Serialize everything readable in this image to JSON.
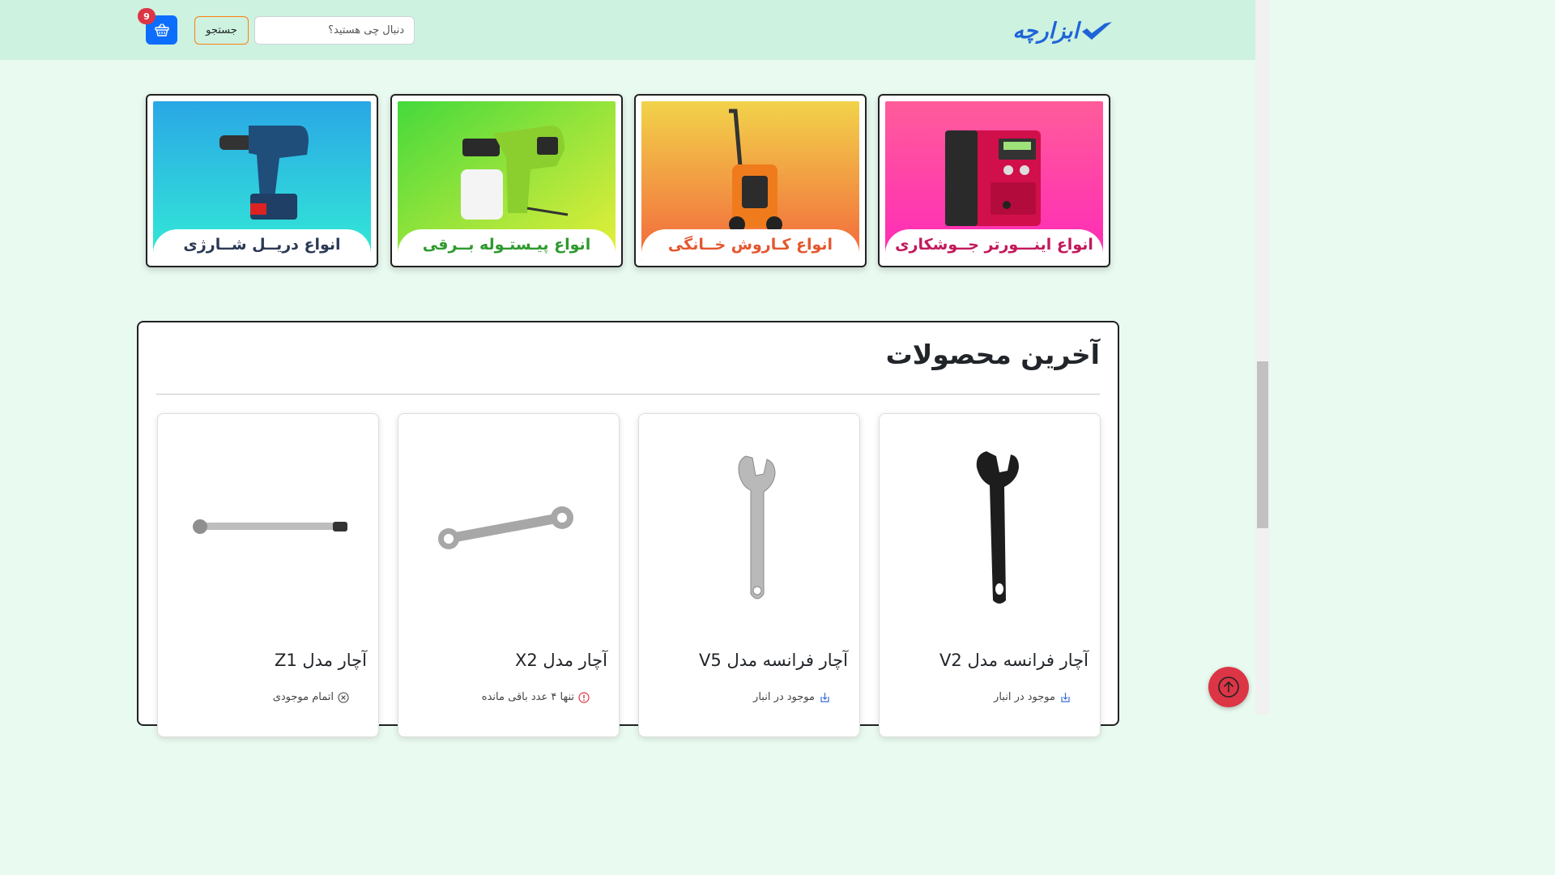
{
  "header": {
    "logo_text": "ابزارچه",
    "search_placeholder": "دنبال چی هستید؟",
    "search_button": "جستجو",
    "cart_count": "9",
    "accent": "#0d6efd",
    "badge_color": "#dc3545"
  },
  "categories": [
    {
      "label": "انواع اینـــورتر جــوشکاری",
      "label_color": "#c2185b",
      "icon": "welding-inverter-image"
    },
    {
      "label": "انواع کـاروش خــانگی",
      "label_color": "#e4572e",
      "icon": "pressure-washer-image"
    },
    {
      "label": "انواع پیـستـوله بــرقی",
      "label_color": "#2e9a2e",
      "icon": "spray-gun-image"
    },
    {
      "label": "انواع دریــل شــارژی",
      "label_color": "#2b3a55",
      "icon": "cordless-drill-image"
    }
  ],
  "latest": {
    "title": "آخرین محصولات",
    "products": [
      {
        "name": "آچار فرانسه مدل V2",
        "status": "موجود در انبار",
        "status_icon": "box-arrow-in-icon",
        "image": "black-adjustable-wrench"
      },
      {
        "name": "آچار فرانسه مدل V5",
        "status": "موجود در انبار",
        "status_icon": "box-arrow-in-icon",
        "image": "chrome-adjustable-wrench"
      },
      {
        "name": "آچار مدل X2",
        "status": "تنها ۴ عدد باقی مانده",
        "status_icon": "exclamation-circle-icon",
        "image": "open-end-wrench"
      },
      {
        "name": "آچار مدل Z1",
        "status": "اتمام موجودی",
        "status_icon": "x-circle-icon",
        "image": "torque-wrench"
      }
    ]
  }
}
